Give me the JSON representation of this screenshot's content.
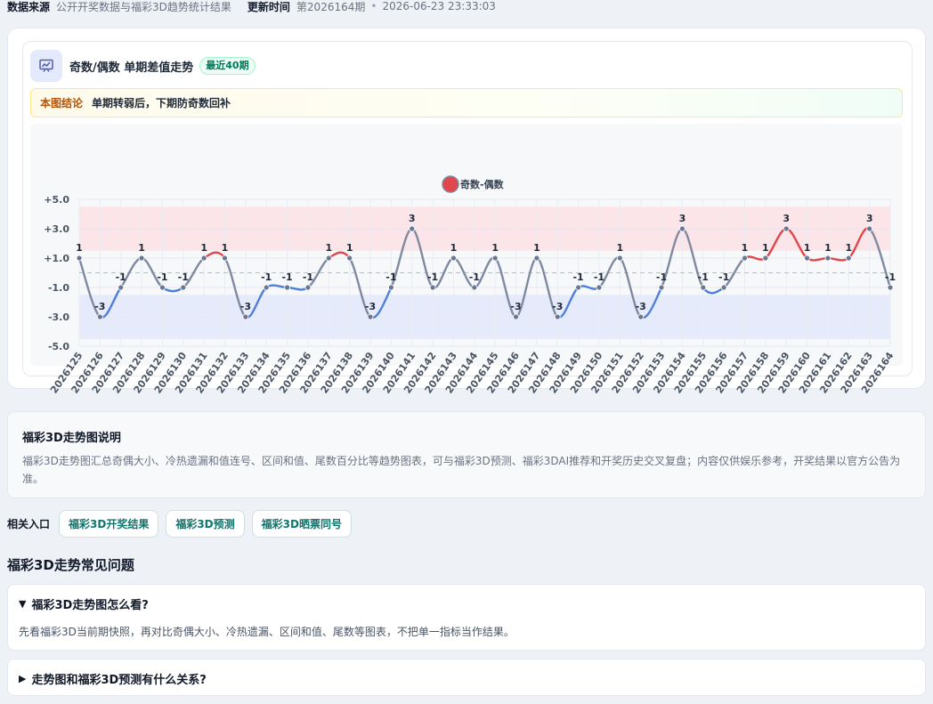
{
  "meta": {
    "source_label": "数据来源",
    "source_value": "公开开奖数据与福彩3D趋势统计结果",
    "update_label": "更新时间",
    "update_period": "第2026164期",
    "update_time": "2026-06-23 23:33:03"
  },
  "chart_card": {
    "icon": "chart-icon",
    "title": "奇数/偶数 单期差值走势",
    "badge": "最近40期",
    "conclusion_label": "本图结论",
    "conclusion_text": "单期转弱后，下期防奇数回补"
  },
  "chart_data": {
    "type": "line",
    "legend": [
      "奇数-偶数"
    ],
    "legend_position": "top-center",
    "ylim": [
      -5,
      5
    ],
    "y_ticks": [
      "+5.0",
      "+3.0",
      "+1.0",
      "-1.0",
      "-3.0",
      "-5.0"
    ],
    "grid": true,
    "bands": [
      {
        "from": 1.5,
        "to": 4.5,
        "color": "#fde2e4"
      },
      {
        "from": -4.5,
        "to": -1.5,
        "color": "#e3e9fb"
      }
    ],
    "reference_line": 0,
    "colors": {
      "up": "#e0474c",
      "down": "#4f7fd6",
      "neutral": "#7f8aa0"
    },
    "x": [
      "2026125",
      "2026126",
      "2026127",
      "2026128",
      "2026129",
      "2026130",
      "2026131",
      "2026132",
      "2026133",
      "2026134",
      "2026135",
      "2026136",
      "2026137",
      "2026138",
      "2026139",
      "2026140",
      "2026141",
      "2026142",
      "2026143",
      "2026144",
      "2026145",
      "2026146",
      "2026147",
      "2026148",
      "2026149",
      "2026150",
      "2026151",
      "2026152",
      "2026153",
      "2026154",
      "2026155",
      "2026156",
      "2026157",
      "2026158",
      "2026159",
      "2026160",
      "2026161",
      "2026162",
      "2026163",
      "2026164"
    ],
    "series": [
      {
        "name": "奇数-偶数",
        "values": [
          1,
          -3,
          -1,
          1,
          -1,
          -1,
          1,
          1,
          -3,
          -1,
          -1,
          -1,
          1,
          1,
          -3,
          -1,
          3,
          -1,
          1,
          -1,
          1,
          -3,
          1,
          -3,
          -1,
          -1,
          1,
          -3,
          -1,
          3,
          -1,
          -1,
          1,
          1,
          3,
          1,
          1,
          1,
          3,
          -1
        ]
      }
    ]
  },
  "info": {
    "title": "福彩3D走势图说明",
    "desc": "福彩3D走势图汇总奇偶大小、冷热遗漏和值连号、区间和值、尾数百分比等趋势图表，可与福彩3D预测、福彩3DAI推荐和开奖历史交叉复盘；内容仅供娱乐参考，开奖结果以官方公告为准。"
  },
  "related": {
    "label": "相关入口",
    "links": [
      "福彩3D开奖结果",
      "福彩3D预测",
      "福彩3D晒票同号"
    ]
  },
  "faq": {
    "heading": "福彩3D走势常见问题",
    "items": [
      {
        "q": "福彩3D走势图怎么看?",
        "a": "先看福彩3D当前期快照，再对比奇偶大小、冷热遗漏、区间和值、尾数等图表，不把单一指标当作结果。",
        "open": true
      },
      {
        "q": "走势图和福彩3D预测有什么关系?",
        "open": false
      }
    ]
  }
}
